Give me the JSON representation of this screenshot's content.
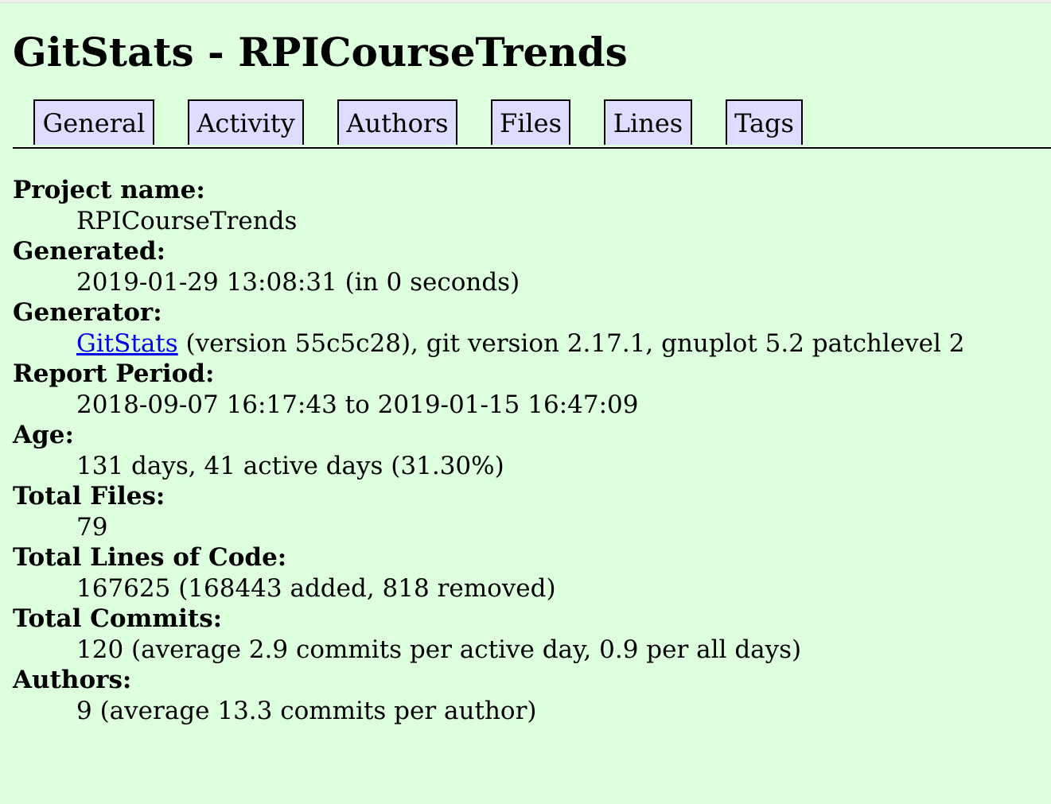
{
  "page": {
    "title": "GitStats - RPICourseTrends"
  },
  "nav": {
    "tabs": [
      {
        "label": "General"
      },
      {
        "label": "Activity"
      },
      {
        "label": "Authors"
      },
      {
        "label": "Files"
      },
      {
        "label": "Lines"
      },
      {
        "label": "Tags"
      }
    ]
  },
  "info": {
    "project_name": {
      "label": "Project name:",
      "value": "RPICourseTrends"
    },
    "generated": {
      "label": "Generated:",
      "value": "2019-01-29 13:08:31 (in 0 seconds)"
    },
    "generator": {
      "label": "Generator:",
      "link_text": "GitStats",
      "rest": " (version 55c5c28), git version 2.17.1, gnuplot 5.2 patchlevel 2"
    },
    "report_period": {
      "label": "Report Period:",
      "value": "2018-09-07 16:17:43 to 2019-01-15 16:47:09"
    },
    "age": {
      "label": "Age:",
      "value": "131 days, 41 active days (31.30%)"
    },
    "total_files": {
      "label": "Total Files:",
      "value": "79"
    },
    "total_loc": {
      "label": "Total Lines of Code:",
      "value": "167625 (168443 added, 818 removed)"
    },
    "total_commits": {
      "label": "Total Commits:",
      "value": "120 (average 2.9 commits per active day, 0.9 per all days)"
    },
    "authors": {
      "label": "Authors:",
      "value": "9 (average 13.3 commits per author)"
    }
  },
  "colors": {
    "background": "#ddffdd",
    "tab_background": "#ddddff",
    "link": "#0000ee"
  }
}
